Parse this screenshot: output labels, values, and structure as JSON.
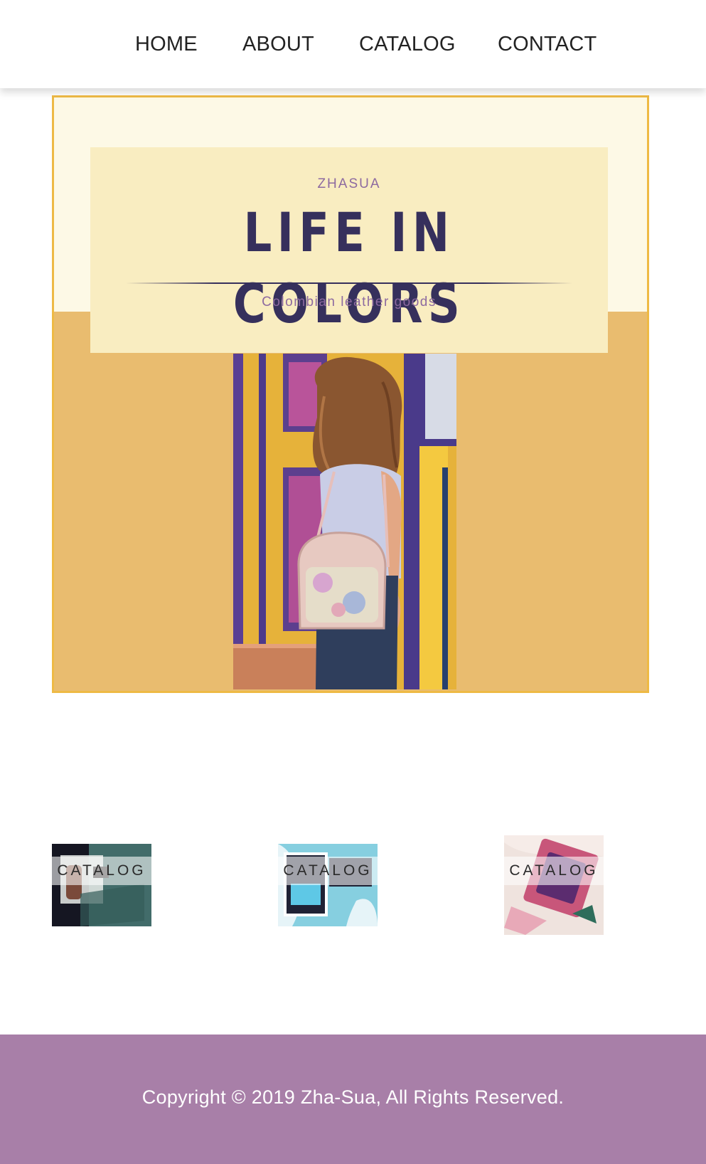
{
  "nav": {
    "items": [
      {
        "label": "HOME"
      },
      {
        "label": "ABOUT"
      },
      {
        "label": "CATALOG"
      },
      {
        "label": "CONTACT"
      }
    ]
  },
  "hero": {
    "brand": "ZHASUA",
    "title": "LIFE IN COLORS",
    "subtitle": "Colombian leather goods",
    "colors": {
      "border": "#eeba45",
      "background": "#e9bc6f",
      "top_band": "#fdf9e6",
      "card": "#f9edc1",
      "title": "#36305c",
      "accent_text": "#8d6aa0"
    }
  },
  "catalog_tiles": [
    {
      "label": "CATALOG"
    },
    {
      "label": "CATALOG"
    },
    {
      "label": "CATALOG"
    }
  ],
  "footer": {
    "copyright": "Copyright © 2019 Zha-Sua, All Rights Reserved.",
    "background": "#a87fa8"
  }
}
